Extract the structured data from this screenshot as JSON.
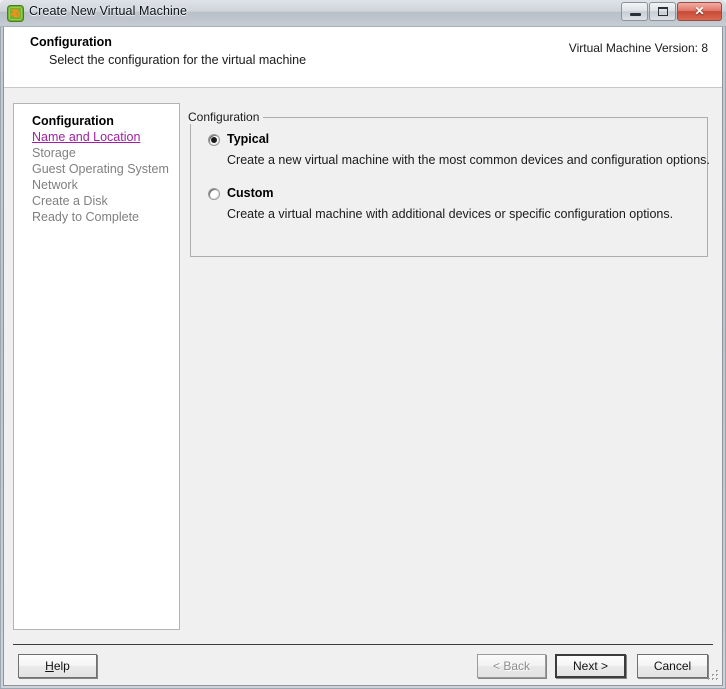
{
  "window": {
    "title": "Create New Virtual Machine",
    "icon": "vm-app-icon",
    "controls": {
      "minimize": "minimize-icon",
      "maximize": "maximize-icon",
      "close": "✕"
    }
  },
  "header": {
    "title": "Configuration",
    "subtitle": "Select the configuration for the virtual machine",
    "version": "Virtual Machine Version: 8"
  },
  "sidebar": {
    "items": [
      {
        "label": "Configuration",
        "state": "current"
      },
      {
        "label": "Name and Location",
        "state": "link"
      },
      {
        "label": "Storage",
        "state": "pending"
      },
      {
        "label": "Guest Operating System",
        "state": "pending"
      },
      {
        "label": "Network",
        "state": "pending"
      },
      {
        "label": "Create a Disk",
        "state": "pending"
      },
      {
        "label": "Ready to Complete",
        "state": "pending"
      }
    ]
  },
  "main": {
    "groupbox_label": "Configuration",
    "options": [
      {
        "label": "Typical",
        "description": "Create a new virtual machine with the most common devices and configuration options.",
        "selected": true
      },
      {
        "label": "Custom",
        "description": "Create a virtual machine with additional devices or specific configuration options.",
        "selected": false
      }
    ]
  },
  "footer": {
    "help": "Help",
    "help_mnemonic": "H",
    "help_rest": "elp",
    "back": "< Back",
    "next": "Next >",
    "cancel": "Cancel"
  },
  "colors": {
    "link": "#a020a0",
    "pending_text": "#808080",
    "window_bg": "#f0f0f0",
    "panel_bg": "#ffffff",
    "close_button": "#c74a36"
  }
}
